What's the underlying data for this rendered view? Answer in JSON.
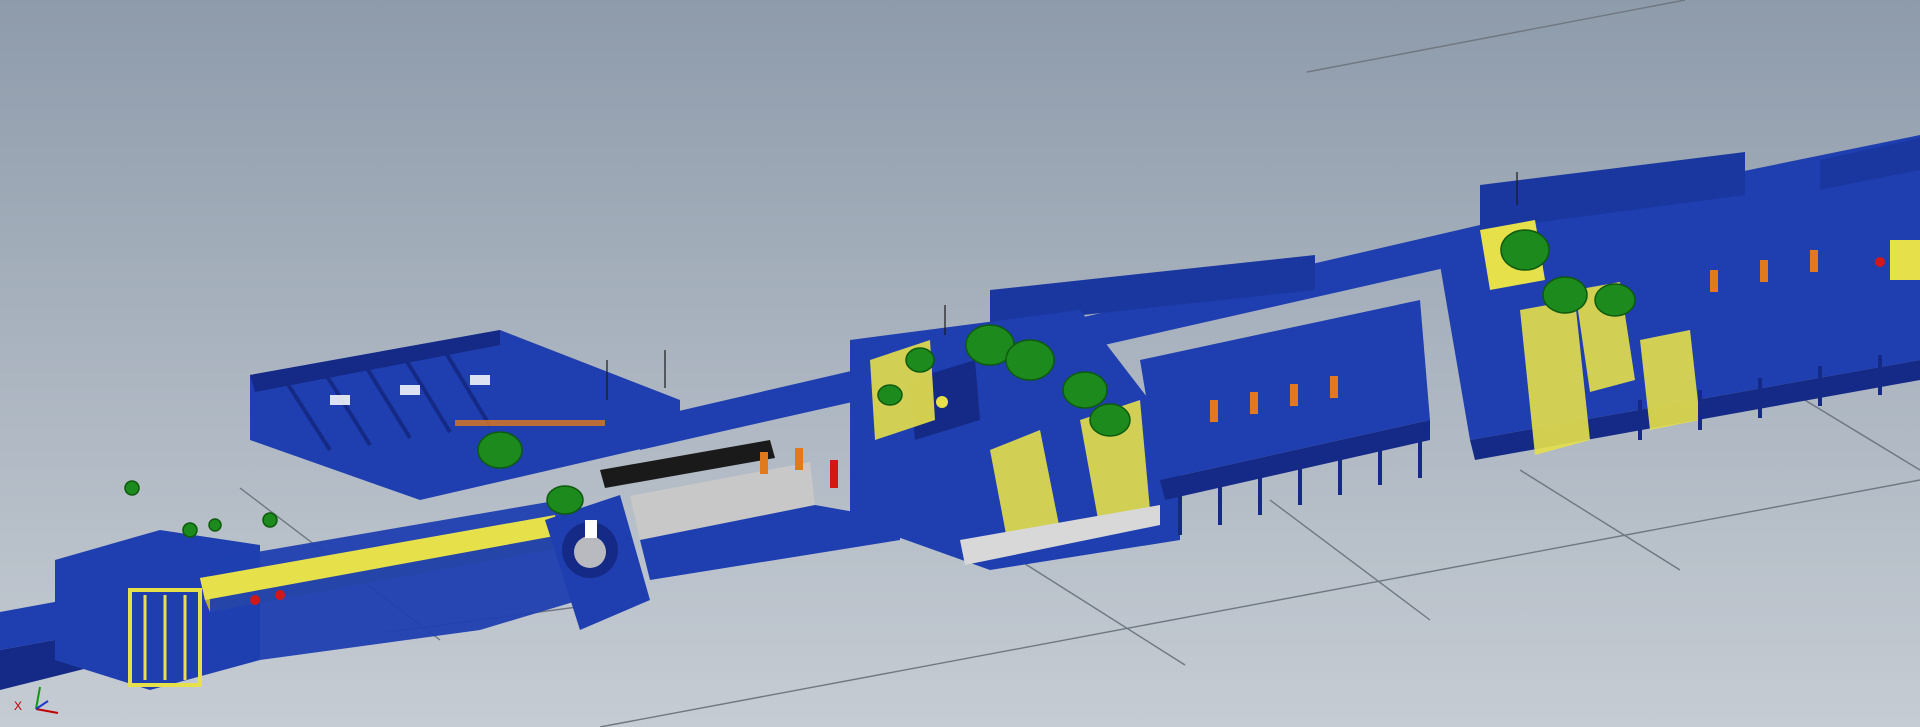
{
  "viewer": {
    "background_top": "#8e9bab",
    "background_bottom": "#c6ccd3"
  },
  "model": {
    "frame_color": "#1f3fb0",
    "frame_dark": "#142a86",
    "guard_color": "#e6e04a",
    "motor_color": "#1c8a1c",
    "accent_orange": "#e07a1c",
    "accent_red": "#d01818",
    "sheet_grey": "#c8c8c8",
    "belt_black": "#1a1a1a"
  },
  "triad": {
    "x_label": "X",
    "x_icon": "x-axis-icon",
    "y_icon": "y-axis-icon",
    "z_icon": "z-axis-icon"
  }
}
